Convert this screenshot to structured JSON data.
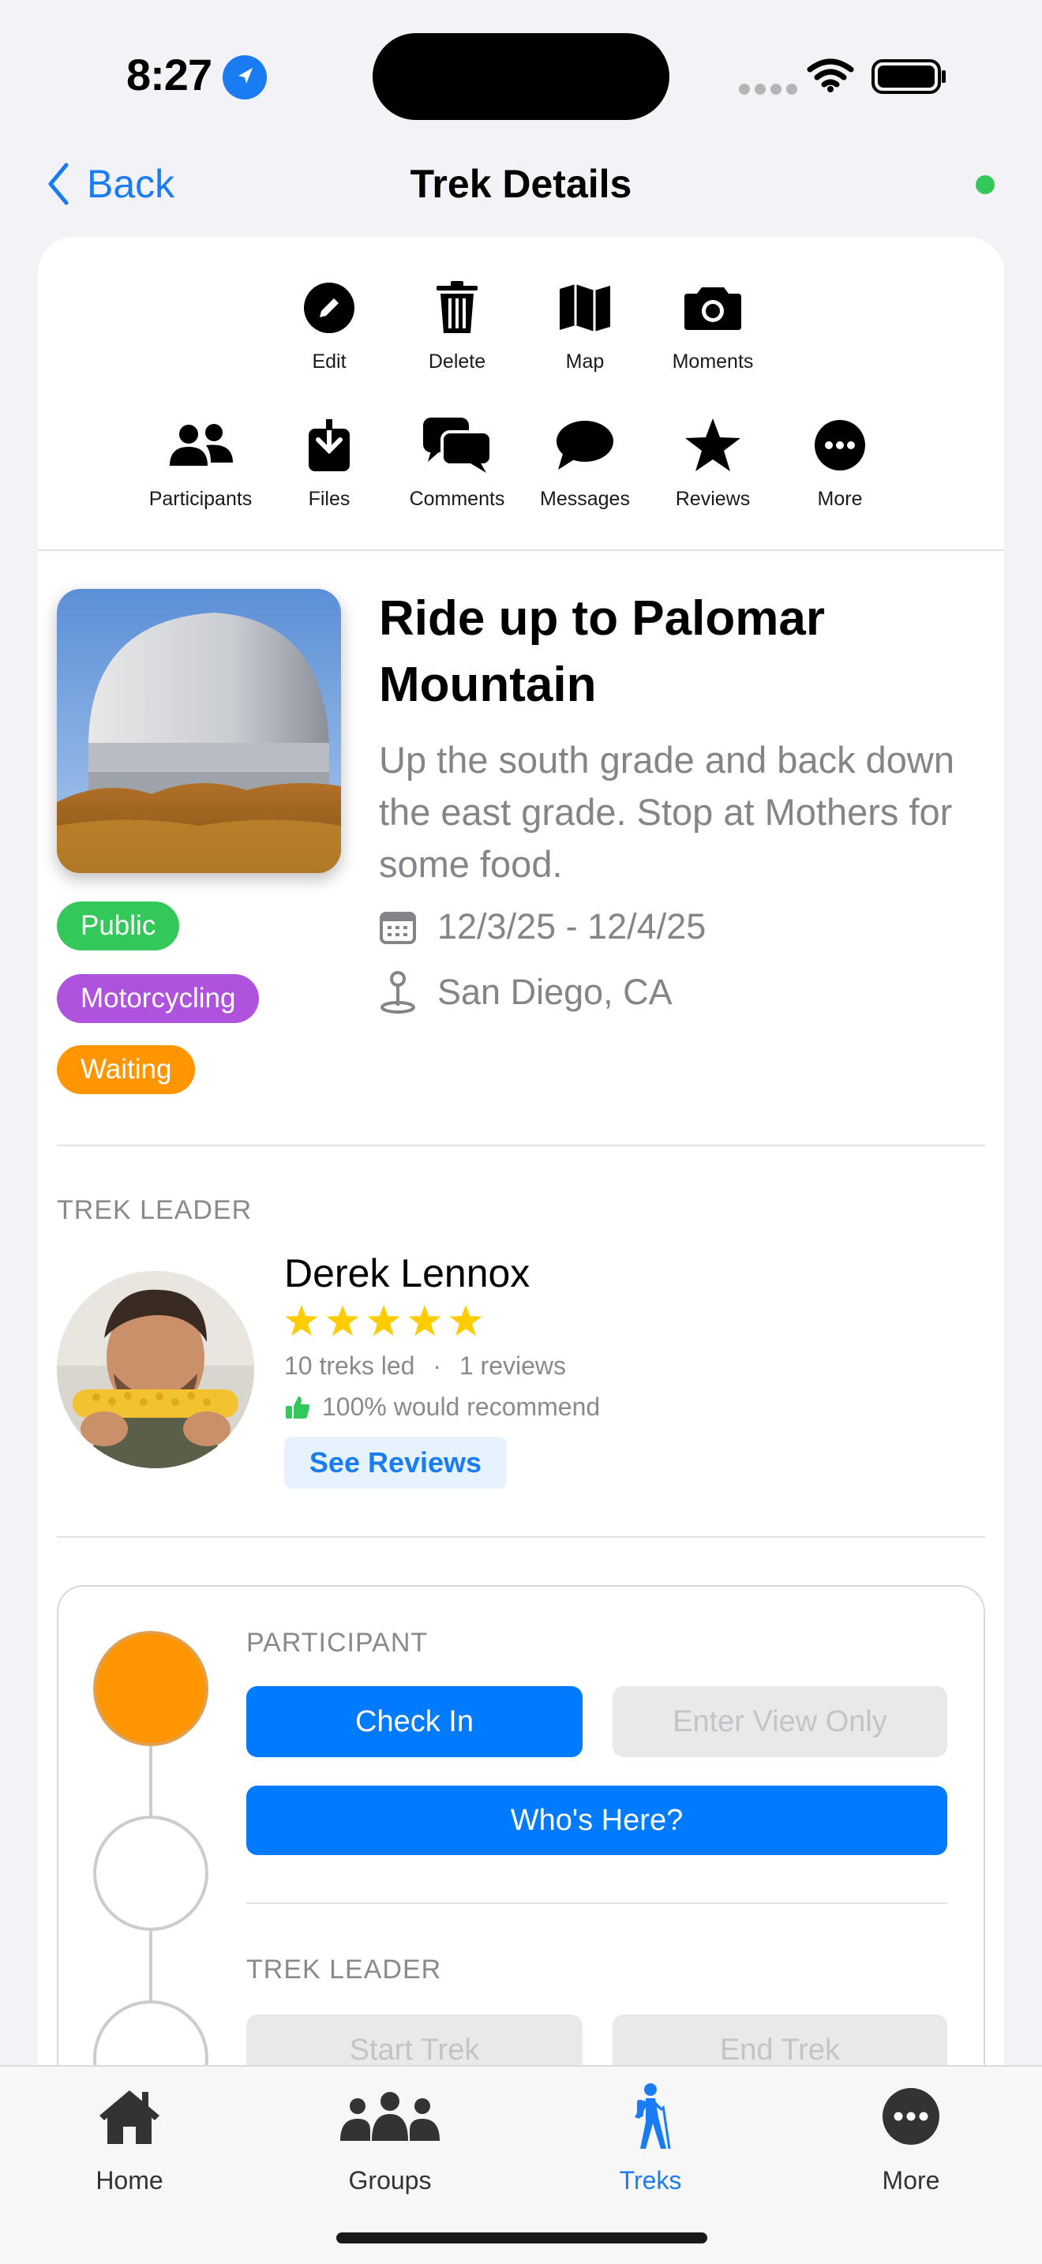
{
  "status_bar": {
    "time": "8:27"
  },
  "nav": {
    "back_label": "Back",
    "title": "Trek Details"
  },
  "actions_row1": [
    {
      "label": "Edit",
      "icon": "pencil-circle-icon"
    },
    {
      "label": "Delete",
      "icon": "trash-icon"
    },
    {
      "label": "Map",
      "icon": "map-icon"
    },
    {
      "label": "Moments",
      "icon": "camera-icon"
    }
  ],
  "actions_row2": [
    {
      "label": "Participants",
      "icon": "people-icon"
    },
    {
      "label": "Files",
      "icon": "file-download-icon"
    },
    {
      "label": "Comments",
      "icon": "comments-icon"
    },
    {
      "label": "Messages",
      "icon": "message-bubble-icon"
    },
    {
      "label": "Reviews",
      "icon": "star-icon"
    },
    {
      "label": "More",
      "icon": "ellipsis-circle-icon"
    }
  ],
  "trek": {
    "title": "Ride up to Palomar Mountain",
    "description": "Up the south grade and back down the east grade.  Stop at Mothers for some food.",
    "dates": "12/3/25 - 12/4/25",
    "location": "San Diego, CA",
    "tags": [
      {
        "label": "Public",
        "color": "#34c759"
      },
      {
        "label": "Motorcycling",
        "color": "#af52de"
      },
      {
        "label": "Waiting",
        "color": "#ff9500"
      }
    ]
  },
  "leader": {
    "section_label": "TREK LEADER",
    "name": "Derek Lennox",
    "rating": 5,
    "treks_led": "10 treks led",
    "separator": "·",
    "reviews": "1 reviews",
    "recommend": "100% would recommend",
    "see_reviews": "See Reviews"
  },
  "participant_section": {
    "label": "PARTICIPANT",
    "check_in": "Check In",
    "enter_view_only": "Enter View Only",
    "whos_here": "Who's Here?"
  },
  "leader_section": {
    "label": "TREK LEADER",
    "start_trek": "Start Trek",
    "end_trek": "End Trek"
  },
  "tabs": [
    {
      "label": "Home",
      "icon": "house-icon"
    },
    {
      "label": "Groups",
      "icon": "groups-icon"
    },
    {
      "label": "Treks",
      "icon": "hiker-icon",
      "active": true
    },
    {
      "label": "More",
      "icon": "ellipsis-circle-icon"
    }
  ],
  "colors": {
    "accent": "#007aff",
    "link": "#1a7cf2",
    "star": "#ffcc00",
    "status_waiting": "#ff9500",
    "online": "#34c759"
  }
}
